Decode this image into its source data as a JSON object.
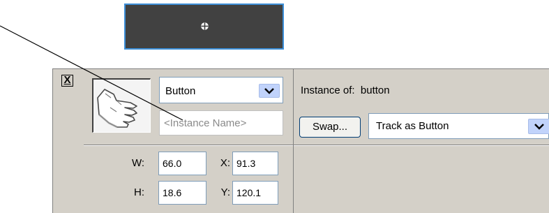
{
  "stage": {
    "symbol_color": "#414141",
    "selection_color": "#3d8fd8",
    "registration_icon": "registration-point-icon"
  },
  "inspector": {
    "close_label": "X",
    "symbol_icon": "hand-pointer-icon",
    "type_select": {
      "value": "Button",
      "icon": "chevron-down-icon"
    },
    "instance_name": {
      "value": "",
      "placeholder": "<Instance Name>"
    },
    "instance_of_label": "Instance of:",
    "instance_of_value": "button",
    "swap_label": "Swap...",
    "behavior_select": {
      "value": "Track as Button",
      "icon": "chevron-down-icon"
    },
    "dimensions": {
      "w_label": "W:",
      "w_value": "66.0",
      "h_label": "H:",
      "h_value": "18.6",
      "x_label": "X:",
      "x_value": "91.3",
      "y_label": "Y:",
      "y_value": "120.1"
    }
  }
}
